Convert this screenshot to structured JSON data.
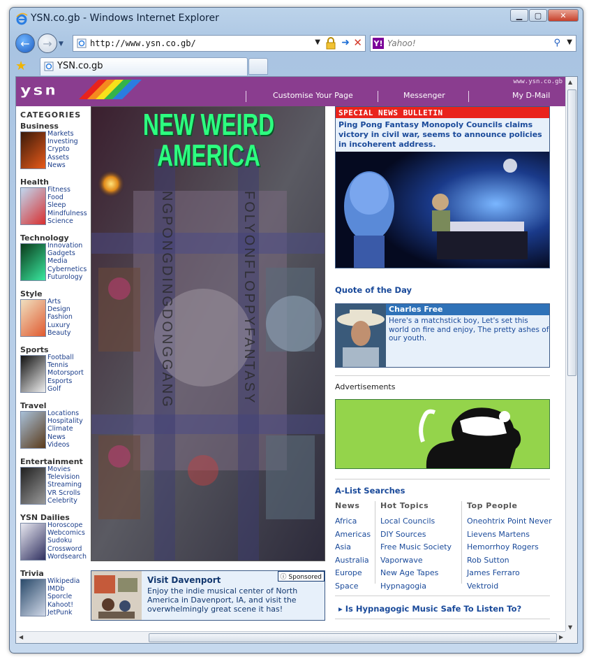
{
  "window": {
    "title": "YSN.co.gb - Windows Internet Explorer"
  },
  "address": {
    "url": "http://www.ysn.co.gb/"
  },
  "search": {
    "placeholder": "Yahoo!"
  },
  "tab": {
    "label": "YSN.co.gb"
  },
  "header": {
    "domain": "www.ysn.co.gb",
    "logo": "ysn",
    "links": [
      "Customise Your Page",
      "Messenger",
      "My D-Mail"
    ]
  },
  "sidebar": {
    "heading": "CATEGORIES",
    "categories": [
      {
        "title": "Business",
        "links": [
          "Markets",
          "Investing",
          "Crypto",
          "Assets",
          "News"
        ]
      },
      {
        "title": "Health",
        "links": [
          "Fitness",
          "Food",
          "Sleep",
          "Mindfulness",
          "Science"
        ]
      },
      {
        "title": "Technology",
        "links": [
          "Innovation",
          "Gadgets",
          "Media",
          "Cybernetics",
          "Futurology"
        ]
      },
      {
        "title": "Style",
        "links": [
          "Arts",
          "Design",
          "Fashion",
          "Luxury",
          "Beauty"
        ]
      },
      {
        "title": "Sports",
        "links": [
          "Football",
          "Tennis",
          "Motorsport",
          "Esports",
          "Golf"
        ]
      },
      {
        "title": "Travel",
        "links": [
          "Locations",
          "Hospitality",
          "Climate",
          "News",
          "Videos"
        ]
      },
      {
        "title": "Entertainment",
        "links": [
          "Movies",
          "Television",
          "Streaming",
          "VR Scrolls",
          "Celebrity"
        ]
      },
      {
        "title": "YSN Dailies",
        "links": [
          "Horoscope",
          "Webcomics",
          "Sudoku",
          "Crossword",
          "Wordsearch"
        ]
      },
      {
        "title": "Trivia",
        "links": [
          "Wikipedia",
          "IMDb",
          "Sporcle",
          "Kahoot!",
          "JetPunk"
        ]
      }
    ]
  },
  "poster": {
    "title_line1": "NEW WEIRD",
    "title_line2": "AMERICA",
    "vertical_left": "NGPONGDINGDONGGANG",
    "vertical_right": "FOLYONFLOPPYFANTASY"
  },
  "sponsored": {
    "title": "Visit Davenport",
    "text": "Enjoy the indie musical center of North America in Davenport, IA, and visit the overwhelmingly great scene it has!",
    "badge": "Sponsored"
  },
  "bulletin": {
    "label": "SPECIAL NEWS BULLETIN",
    "headline": "Ping Pong Fantasy Monopoly Councils claims victory in civil war, seems to announce policies in incoherent address."
  },
  "quote": {
    "section_title": "Quote of the Day",
    "name": "Charles Free",
    "text": "Here's a matchstick boy, Let's set this world on fire and enjoy, The pretty ashes of our youth."
  },
  "ads": {
    "label": "Advertisements"
  },
  "alist": {
    "title": "A-List Searches",
    "columns": [
      {
        "heading": "News",
        "items": [
          "Africa",
          "Americas",
          "Asia",
          "Australia",
          "Europe",
          "Space"
        ]
      },
      {
        "heading": "Hot Topics",
        "items": [
          "Local Councils",
          "DIY Sources",
          "Free Music Society",
          "Vaporwave",
          "New Age Tapes",
          "Hypnagogia"
        ]
      },
      {
        "heading": "Top People",
        "items": [
          "Oneohtrix Point Never",
          "Lievens Martens",
          "Hemorrhoy Rogers",
          "Rob Sutton",
          "James Ferraro",
          "Vektroid"
        ]
      }
    ],
    "footer_link": "Is Hypnagogic Music Safe To Listen To?"
  },
  "colors": {
    "brand": "#8a3d8f",
    "link": "#1a4a9a",
    "alert": "#e9231c",
    "ad_green": "#94d44b"
  }
}
